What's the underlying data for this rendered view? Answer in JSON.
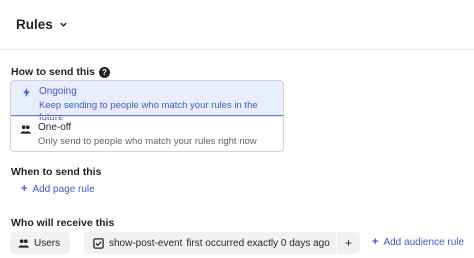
{
  "header": {
    "title": "Rules"
  },
  "how_to_send": {
    "label": "How to send this",
    "help_glyph": "?",
    "options": [
      {
        "title": "Ongoing",
        "description": "Keep sending to people who match your rules in the future",
        "selected": true,
        "icon": "lightning-icon"
      },
      {
        "title": "One-off",
        "description": "Only send to people who match your rules right now",
        "selected": false,
        "icon": "people-icon"
      }
    ]
  },
  "when_to_send": {
    "label": "When to send this",
    "add_page_rule": "Add page rule"
  },
  "who_will_receive": {
    "label": "Who will receive this",
    "users_chip": "Users",
    "event_name": "show-post-event",
    "event_rule": "first occurred exactly 0 days ago",
    "add_glyph": "+",
    "add_audience_rule": "Add audience rule"
  },
  "colors": {
    "accent": "#3b5bdb",
    "selected_bg": "#e8eefc",
    "chip_bg": "#f0f1f3"
  }
}
